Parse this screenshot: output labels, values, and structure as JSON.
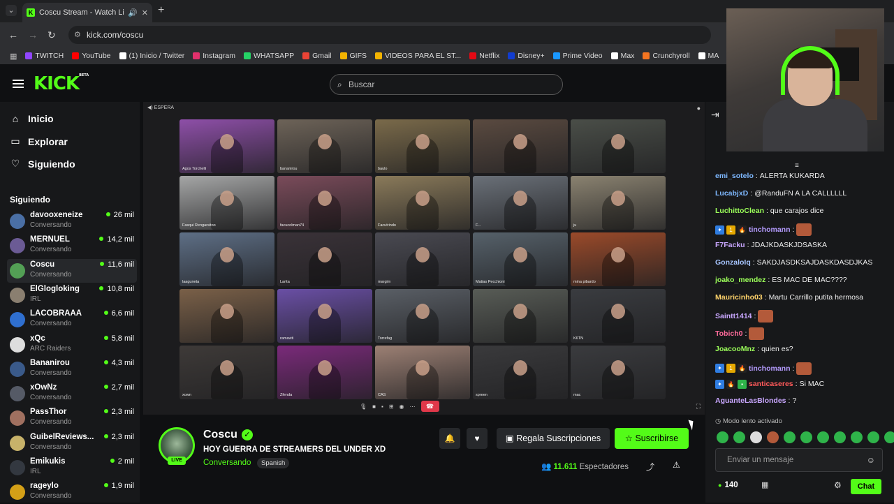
{
  "browser": {
    "tab_title": "Coscu Stream - Watch Live",
    "url": "kick.com/coscu",
    "bookmarks": [
      {
        "label": "TWITCH",
        "color": "#9146ff"
      },
      {
        "label": "YouTube",
        "color": "#ff0000"
      },
      {
        "label": "(1) Inicio / Twitter",
        "color": "#ffffff"
      },
      {
        "label": "Instagram",
        "color": "#e1306c"
      },
      {
        "label": "WHATSAPP",
        "color": "#25d366"
      },
      {
        "label": "Gmail",
        "color": "#ea4335"
      },
      {
        "label": "GIFS",
        "color": "#f4b400"
      },
      {
        "label": "VIDEOS PARA EL ST...",
        "color": "#f4b400"
      },
      {
        "label": "Netflix",
        "color": "#e50914"
      },
      {
        "label": "Disney+",
        "color": "#113ccf"
      },
      {
        "label": "Prime Video",
        "color": "#1a98ff"
      },
      {
        "label": "Max",
        "color": "#ffffff"
      },
      {
        "label": "Crunchyroll",
        "color": "#f47521"
      },
      {
        "label": "MA",
        "color": "#ffffff"
      }
    ]
  },
  "header": {
    "logo": "KICK",
    "logo_beta": "BETA",
    "search_placeholder": "Buscar"
  },
  "sidebar": {
    "nav": [
      "Inicio",
      "Explorar",
      "Siguiendo"
    ],
    "following_title": "Siguiendo",
    "channels": [
      {
        "name": "davooxeneize",
        "category": "Conversando",
        "viewers": "26 mil",
        "color": "#4a6fa5"
      },
      {
        "name": "MERNUEL",
        "category": "Conversando",
        "viewers": "14,2 mil",
        "color": "#6b5b95"
      },
      {
        "name": "Coscu",
        "category": "Conversando",
        "viewers": "11,6 mil",
        "color": "#53a055"
      },
      {
        "name": "ElGlogloking",
        "category": "IRL",
        "viewers": "10,8 mil",
        "color": "#8a7f70"
      },
      {
        "name": "LACOBRAAA",
        "category": "Conversando",
        "viewers": "6,6 mil",
        "color": "#2f6fcf"
      },
      {
        "name": "xQc",
        "category": "ARC Raiders",
        "viewers": "5,8 mil",
        "color": "#dddddd"
      },
      {
        "name": "Bananirou",
        "category": "Conversando",
        "viewers": "4,3 mil",
        "color": "#3a5a8a"
      },
      {
        "name": "xOwNz",
        "category": "Conversando",
        "viewers": "2,7 mil",
        "color": "#555a66"
      },
      {
        "name": "PassThor",
        "category": "Conversando",
        "viewers": "2,3 mil",
        "color": "#a07060"
      },
      {
        "name": "GuibelReviews...",
        "category": "Conversando",
        "viewers": "2,3 mil",
        "color": "#c7b26a"
      },
      {
        "name": "Emikukis",
        "category": "IRL",
        "viewers": "2 mil",
        "color": "#333840"
      },
      {
        "name": "rageylo",
        "category": "Conversando",
        "viewers": "1,9 mil",
        "color": "#d4a017"
      }
    ]
  },
  "video": {
    "header_text": "ESPERA",
    "participants": [
      {
        "name": "Agos Torchelli",
        "bg": "#8e4fa8"
      },
      {
        "name": "bananirou",
        "bg": "#6d6358"
      },
      {
        "name": "baulo",
        "bg": "#7a6a4a"
      },
      {
        "name": "",
        "bg": "#5a4a40"
      },
      {
        "name": "",
        "bg": "#4a4e48"
      },
      {
        "name": "Fasqui Rengarsitoo",
        "bg": "#a5a6a6"
      },
      {
        "name": "facucolman74",
        "bg": "#7a4b5a"
      },
      {
        "name": "Facutrindo",
        "bg": "#8a7a5a"
      },
      {
        "name": "F...",
        "bg": "#6a7078"
      },
      {
        "name": "ju",
        "bg": "#8a8270"
      },
      {
        "name": "laaguneta",
        "bg": "#5e6f86"
      },
      {
        "name": "Larita",
        "bg": "#3a3238"
      },
      {
        "name": "margim",
        "bg": "#4a4a52"
      },
      {
        "name": "Matias Pecchioni",
        "bg": "#56616a"
      },
      {
        "name": "mina pibardo",
        "bg": "#9a4a2a"
      },
      {
        "name": "",
        "bg": "#7a6048"
      },
      {
        "name": "ramaviti",
        "bg": "#6a4fa5"
      },
      {
        "name": "Torrefag",
        "bg": "#5a5f66"
      },
      {
        "name": "",
        "bg": "#585c56"
      },
      {
        "name": "K6TN",
        "bg": "#3a3c40"
      },
      {
        "name": "xown",
        "bg": "#3e3a38"
      },
      {
        "name": "Zfenda",
        "bg": "#7a2a7a"
      },
      {
        "name": "CAS",
        "bg": "#9c8074"
      },
      {
        "name": "spreen",
        "bg": "#3a3a3c"
      },
      {
        "name": "mac",
        "bg": "#3a3b3e"
      }
    ]
  },
  "stream": {
    "name": "Coscu",
    "title": "HOY GUERRA DE STREAMERS DEL UNDER XD",
    "category": "Conversando",
    "language": "Spanish",
    "live_label": "LIVE",
    "gift_label": "Regala Suscripciones",
    "subscribe_label": "Suscribirse",
    "viewers_count": "11.611",
    "viewers_label": "Espectadores"
  },
  "chat": {
    "messages": [
      {
        "user": "emi_sotelo",
        "color": "#7eb8ff",
        "text": "ALERTA KUKARDA",
        "badges": []
      },
      {
        "user": "LucabjxD",
        "color": "#7eb8ff",
        "text": "@RanduFN A LA CALLLLLL",
        "badges": []
      },
      {
        "user": "LuchittoClean",
        "color": "#9cff5a",
        "text": "que carajos dice",
        "badges": []
      },
      {
        "user": "tinchomann",
        "color": "#b59cff",
        "text": "",
        "badges": [
          "blue",
          "gold",
          "fire"
        ],
        "emote": true
      },
      {
        "user": "F7Facku",
        "color": "#c9a7ff",
        "text": "JDAJKDASKJDSASKA",
        "badges": []
      },
      {
        "user": "GonzaloIq",
        "color": "#a7c5ff",
        "text": "SAKDJASDKSAJDASKDASDJKAS",
        "badges": []
      },
      {
        "user": "joako_mendez",
        "color": "#9cff5a",
        "text": "ES MAC DE MAC????",
        "badges": []
      },
      {
        "user": "Mauricinho03",
        "color": "#ffd36b",
        "text": "Martu Carrillo putita hermosa",
        "badges": []
      },
      {
        "user": "Saintt1414",
        "color": "#c9a7ff",
        "text": "",
        "badges": [],
        "emote": true
      },
      {
        "user": "Tobich0",
        "color": "#ff6b9b",
        "text": "",
        "badges": [],
        "emote": true
      },
      {
        "user": "JoacooMnz",
        "color": "#9cff5a",
        "text": "quien es?",
        "badges": []
      },
      {
        "user": "tinchomann",
        "color": "#b59cff",
        "text": "",
        "badges": [
          "blue",
          "gold",
          "fire"
        ],
        "emote": true
      },
      {
        "user": "santicaseres",
        "color": "#ff5a5a",
        "text": "Si MAC",
        "badges": [
          "blue",
          "fire",
          "green"
        ]
      },
      {
        "user": "AguanteLasBlondes",
        "color": "#c9a7ff",
        "text": "?",
        "badges": []
      }
    ],
    "slow_mode": "Modo lento activado",
    "input_placeholder": "Enviar un mensaje",
    "points": "140",
    "chat_button": "Chat"
  }
}
